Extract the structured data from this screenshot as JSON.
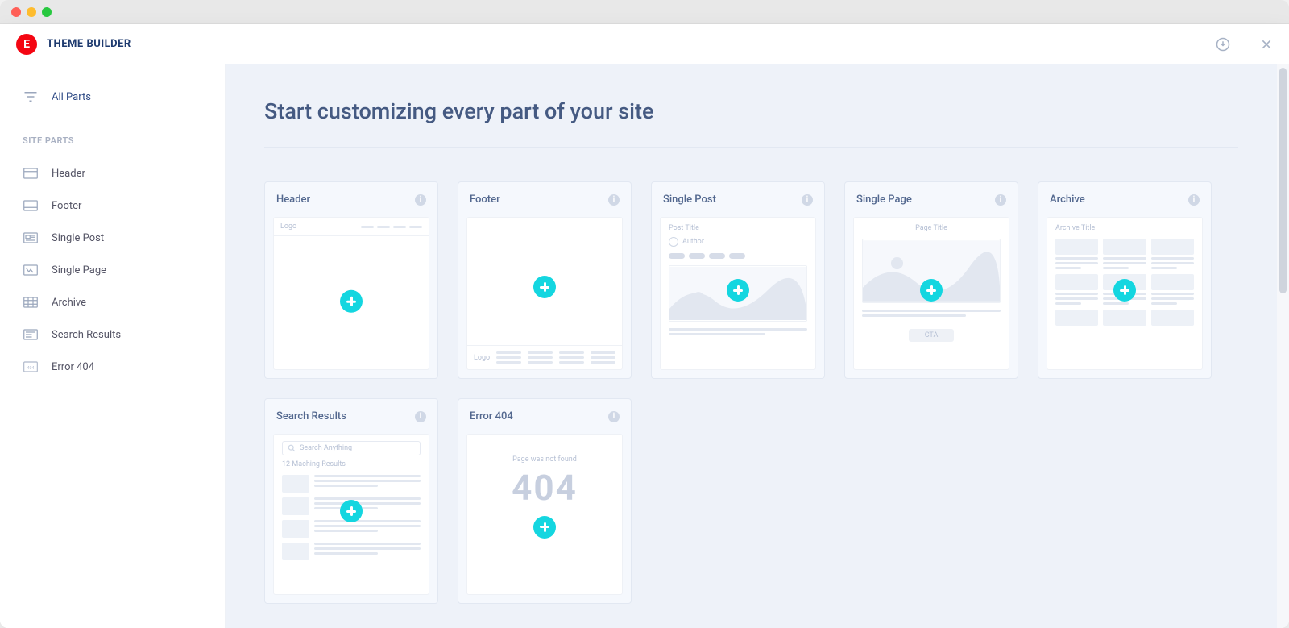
{
  "brand": {
    "title": "THEME BUILDER"
  },
  "sidebar": {
    "all_parts": "All Parts",
    "heading": "SITE PARTS",
    "items": [
      {
        "label": "Header"
      },
      {
        "label": "Footer"
      },
      {
        "label": "Single Post"
      },
      {
        "label": "Single Page"
      },
      {
        "label": "Archive"
      },
      {
        "label": "Search Results"
      },
      {
        "label": "Error 404"
      }
    ]
  },
  "page": {
    "title": "Start customizing every part of your site"
  },
  "cards": [
    {
      "label": "Header"
    },
    {
      "label": "Footer"
    },
    {
      "label": "Single Post"
    },
    {
      "label": "Single Page"
    },
    {
      "label": "Archive"
    },
    {
      "label": "Search Results"
    },
    {
      "label": "Error 404"
    }
  ],
  "preview": {
    "header_logo": "Logo",
    "footer_logo": "Logo",
    "post_title": "Post Title",
    "post_author": "Author",
    "page_title": "Page Title",
    "page_cta": "CTA",
    "archive_title": "Archive Title",
    "search_placeholder": "Search Anything",
    "search_results_count": "12 Maching Results",
    "error404_msg": "Page was not found",
    "error404_code": "404"
  }
}
